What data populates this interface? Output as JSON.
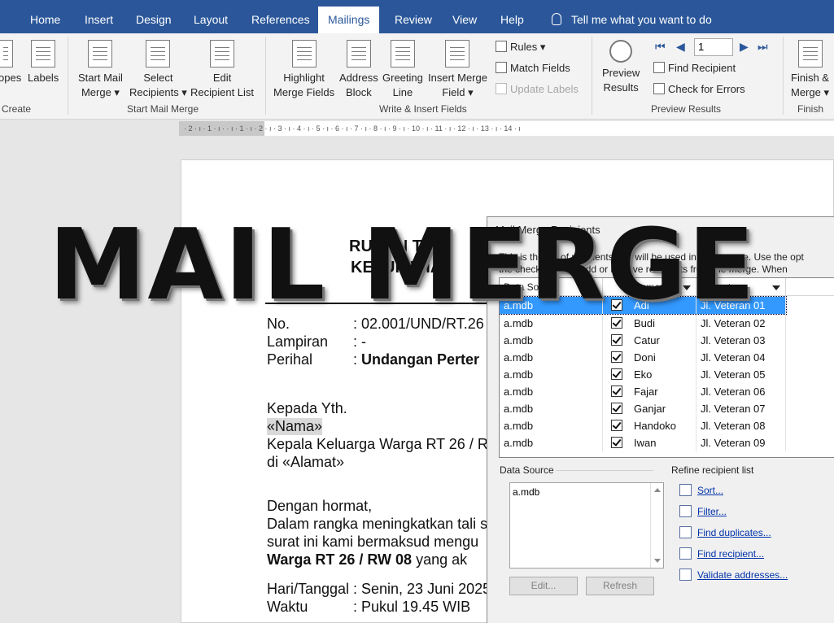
{
  "tabs": [
    "Home",
    "Insert",
    "Design",
    "Layout",
    "References",
    "Mailings",
    "Review",
    "View",
    "Help"
  ],
  "active_tab": "Mailings",
  "tell_me": "Tell me what you want to do",
  "ribbon": {
    "create": {
      "envelopes": "opes",
      "labels": "Labels",
      "group": "Create"
    },
    "start": {
      "start_mail_merge": [
        "Start Mail",
        "Merge ▾"
      ],
      "select_recipients": [
        "Select",
        "Recipients ▾"
      ],
      "edit_list": [
        "Edit",
        "Recipient List"
      ],
      "group": "Start Mail Merge"
    },
    "write": {
      "highlight": [
        "Highlight",
        "Merge Fields"
      ],
      "address": [
        "Address",
        "Block"
      ],
      "greeting": [
        "Greeting",
        "Line"
      ],
      "insert_field": [
        "Insert Merge",
        "Field ▾"
      ],
      "rules": "Rules ▾",
      "match_fields": "Match Fields",
      "update_labels": "Update Labels",
      "group": "Write & Insert Fields"
    },
    "preview": {
      "preview_results": [
        "Preview",
        "Results"
      ],
      "record": "1",
      "find_recipient": "Find Recipient",
      "check_errors": "Check for Errors",
      "group": "Preview Results"
    },
    "finish": {
      "finish_merge": [
        "Finish &",
        "Merge ▾"
      ],
      "group": "Finish"
    }
  },
  "ruler": "· 2 · ı · 1 · ı ·     · ı · 1 · ı · 2 · ı · 3 · ı · 4 · ı · 5 · ı · 6 · ı · 7 · ı · 8 · ı · 9 · ı · 10 · ı · 11 · ı · 12 · ı · 13 · ı · 14 · ı",
  "doc": {
    "heading1": "RUKUN TET",
    "heading2": "KELURAHAN",
    "no_label": "No.",
    "no_value": ": 02.001/UND/RT.26",
    "lampiran_label": "Lampiran",
    "lampiran_value": ": -",
    "perihal_label": "Perihal",
    "perihal_colon": ": ",
    "perihal_value": "Undangan Perter",
    "kepada": "Kepada Yth.",
    "nama_field": "«Nama»",
    "kepala": "Kepala Keluarga Warga RT 26 / R",
    "di_alamat": "di «Alamat»",
    "hormat": "Dengan hormat,",
    "body1": "Dalam rangka meningkatkan tali s",
    "body2": "surat ini kami bermaksud mengu",
    "body3_bold": "Warga RT 26 / RW 08",
    "body3_rest": " yang ak",
    "hari_label": "Hari/Tanggal",
    "hari_value": ": Senin, 23 Juni 2025",
    "waktu_label": "Waktu",
    "waktu_value": ": Pukul 19.45 WIB"
  },
  "dialog": {
    "title": "Mail Merge Recipients",
    "desc1": "This is the list of recipients that will be used in your merge.  Use the opt",
    "desc2": "the checkboxes to add or remove recipients from the merge.  When",
    "columns": [
      "Data Source",
      "",
      "Name",
      "Alamat"
    ],
    "rows": [
      {
        "source": "a.mdb",
        "name": "Adi",
        "alamat": "Jl. Veteran 01"
      },
      {
        "source": "a.mdb",
        "name": "Budi",
        "alamat": "Jl. Veteran 02"
      },
      {
        "source": "a.mdb",
        "name": "Catur",
        "alamat": "Jl. Veteran 03"
      },
      {
        "source": "a.mdb",
        "name": "Doni",
        "alamat": "Jl. Veteran 04"
      },
      {
        "source": "a.mdb",
        "name": "Eko",
        "alamat": "Jl. Veteran 05"
      },
      {
        "source": "a.mdb",
        "name": "Fajar",
        "alamat": "Jl. Veteran 06"
      },
      {
        "source": "a.mdb",
        "name": "Ganjar",
        "alamat": "Jl. Veteran 07"
      },
      {
        "source": "a.mdb",
        "name": "Handoko",
        "alamat": "Jl. Veteran 08"
      },
      {
        "source": "a.mdb",
        "name": "Iwan",
        "alamat": "Jl. Veteran 09"
      }
    ],
    "data_source_label": "Data Source",
    "data_source_item": "a.mdb",
    "edit_button": "Edit...",
    "refresh_button": "Refresh",
    "refine_label": "Refine recipient list",
    "refine_links": [
      "Sort...",
      "Filter...",
      "Find duplicates...",
      "Find recipient...",
      "Validate addresses..."
    ]
  },
  "overlay_title": "MAIL MERGE",
  "colors": {
    "accent": "#2b579a",
    "selection": "#3399ff",
    "link": "#0033aa"
  }
}
